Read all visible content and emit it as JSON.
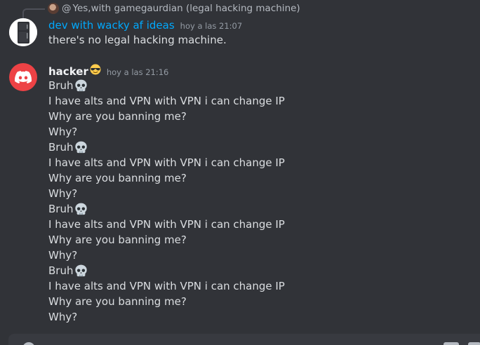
{
  "reply": {
    "at": "@",
    "text": "Yes,with gamegaurdian (legal hacking machine)"
  },
  "messages": [
    {
      "username": "dev with wacky af ideas",
      "timestamp": "hoy a las 21:07",
      "lines": [
        "there's no legal hacking machine."
      ]
    },
    {
      "username": "hacker",
      "timestamp": "hoy a las 21:16",
      "blocks": [
        {
          "bruh": "Bruh",
          "l1": "I have alts and VPN with VPN i can change IP",
          "l2": "Why are you banning me?",
          "l3": "Why?"
        },
        {
          "bruh": "Bruh",
          "l1": "I have alts and VPN with VPN i can change IP",
          "l2": "Why are you banning me?",
          "l3": "Why?"
        },
        {
          "bruh": "Bruh",
          "l1": "I have alts and VPN with VPN i can change IP",
          "l2": "Why are you banning me?",
          "l3": "Why?"
        },
        {
          "bruh": "Bruh",
          "l1": "I have alts and VPN with VPN i can change IP",
          "l2": "Why are you banning me?",
          "l3": "Why?"
        }
      ]
    }
  ],
  "icons": {
    "reply_avatar": "user-avatar-icon",
    "dev_avatar": "fridge-avatar-icon",
    "hacker_avatar": "discord-logo-icon",
    "cool_emoji": "sunglasses-emoji-icon",
    "skull_emoji": "skull-emoji-icon"
  },
  "colors": {
    "background": "#313338",
    "dev_name": "#00a8fc",
    "hacker_avatar": "#ed4245",
    "text": "#dbdee1",
    "muted": "#949ba4"
  }
}
